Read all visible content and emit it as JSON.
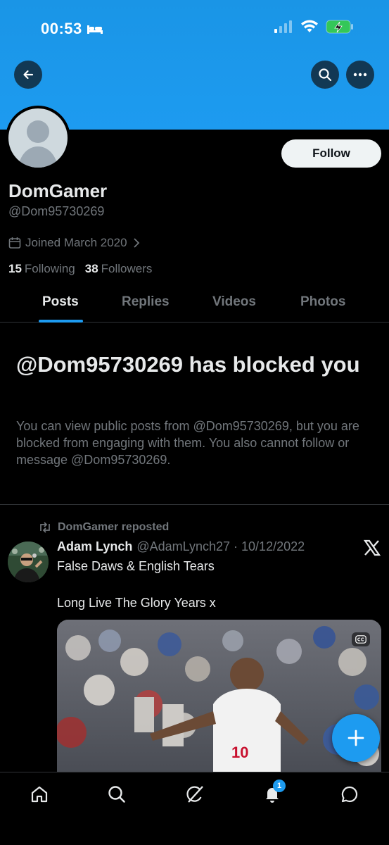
{
  "status_bar": {
    "time": "00:53"
  },
  "profile": {
    "display_name": "DomGamer",
    "handle": "@Dom95730269",
    "joined": "Joined March 2020",
    "following_count": "15",
    "following_label": "Following",
    "followers_count": "38",
    "followers_label": "Followers",
    "follow_button": "Follow"
  },
  "tabs": [
    {
      "label": "Posts",
      "active": true
    },
    {
      "label": "Replies",
      "active": false
    },
    {
      "label": "Videos",
      "active": false
    },
    {
      "label": "Photos",
      "active": false
    }
  ],
  "blocked": {
    "title": "@Dom95730269 has blocked you",
    "body": "You can view public posts from @Dom95730269, but you are blocked from engaging with them. You also cannot follow or message @Dom95730269."
  },
  "post": {
    "repost_label": "DomGamer reposted",
    "author": "Adam Lynch",
    "meta": "@AdamLynch27 · 10/12/2022",
    "text_line1": "False Daws & English Tears",
    "text_line2": "Long Live The Glory Years x",
    "jersey_number": "10"
  },
  "nav": {
    "notifications_badge": "1"
  },
  "colors": {
    "accent": "#1d9bf0",
    "background": "#000000",
    "muted": "#71767b",
    "text": "#e7e9ea"
  },
  "icons": [
    "back-arrow-icon",
    "search-icon",
    "more-icon",
    "calendar-icon",
    "chevron-right-icon",
    "repost-icon",
    "x-logo-icon",
    "cc-icon",
    "plus-icon",
    "home-icon",
    "search-nav-icon",
    "grok-icon",
    "bell-icon",
    "chat-icon"
  ]
}
